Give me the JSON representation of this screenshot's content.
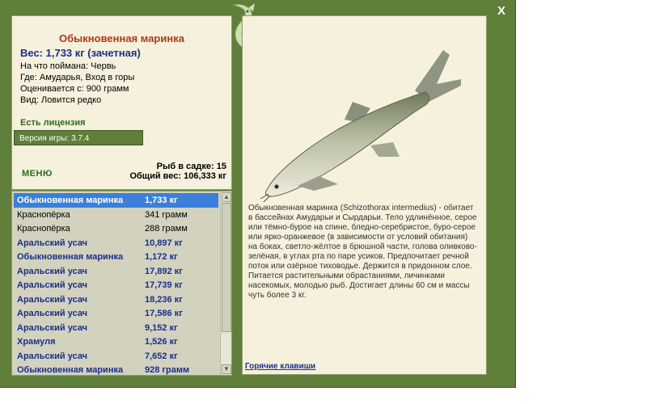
{
  "window": {
    "close_label": "X"
  },
  "fish": {
    "title": "Обыкновенная маринка",
    "weight": "Вес: 1,733 кг (зачетная)",
    "details": [
      "На что поймана: Червь",
      "Где: Амударья, Вход в горы",
      "Оценивается с: 900 грамм",
      "Вид: Ловится редко"
    ],
    "description": "Обыкновенная маринка (Schizothorax intermedius) - обитает в бассейнах Амударьи и Сырдарьи. Тело удлинённое, серое или тёмно-бурое на спине, бледно-серебристое, буро-серое или ярко-оранжевое (в зависимости от условий обитания) на боках, светло-жёлтое в брюшной части, голова оливково-зелёная, в углах рта по паре усиков. Предпочитает речной поток или озёрное тиховодье. Держится в придонном слое. Питается растительными обрастаниями, личинками насекомых, молодью рыб. Достигает длины 60 см и массы чуть более 3 кг."
  },
  "status": {
    "license": "Есть лицензия",
    "version": "Версия игры: 3.7.4",
    "keep_net_count": "Рыб в садке: 15",
    "total_weight": "Общий вес: 106,333 кг"
  },
  "menu": {
    "label": "МЕНЮ"
  },
  "links": {
    "hotkeys": "Горячие клавиши"
  },
  "catch_list": [
    {
      "name": "Обыкновенная маринка",
      "weight": "1,733 кг",
      "trophy": true,
      "selected": true
    },
    {
      "name": "Краснопёрка",
      "weight": "341 грамм",
      "trophy": false,
      "selected": false
    },
    {
      "name": "Краснопёрка",
      "weight": "288 грамм",
      "trophy": false,
      "selected": false
    },
    {
      "name": "Аральский усач",
      "weight": "10,897 кг",
      "trophy": true,
      "selected": false
    },
    {
      "name": "Обыкновенная маринка",
      "weight": "1,172 кг",
      "trophy": true,
      "selected": false
    },
    {
      "name": "Аральский усач",
      "weight": "17,892 кг",
      "trophy": true,
      "selected": false
    },
    {
      "name": "Аральский усач",
      "weight": "17,739 кг",
      "trophy": true,
      "selected": false
    },
    {
      "name": "Аральский усач",
      "weight": "18,236 кг",
      "trophy": true,
      "selected": false
    },
    {
      "name": "Аральский усач",
      "weight": "17,586 кг",
      "trophy": true,
      "selected": false
    },
    {
      "name": "Аральский усач",
      "weight": "9,152 кг",
      "trophy": true,
      "selected": false
    },
    {
      "name": "Храмуля",
      "weight": "1,526 кг",
      "trophy": true,
      "selected": false
    },
    {
      "name": "Аральский усач",
      "weight": "7,652 кг",
      "trophy": true,
      "selected": false
    },
    {
      "name": "Обыкновенная маринка",
      "weight": "928 грамм",
      "trophy": true,
      "selected": false
    }
  ],
  "colors": {
    "frame_green": "#5f7f3a",
    "panel_cream": "#f5f1dc",
    "title_red": "#b0381a",
    "trophy_blue": "#1a2f8a",
    "license_green": "#2e6b1f",
    "selection_blue": "#3b7fd9"
  },
  "icons": {
    "logo": "fish-logo-icon",
    "close": "close-icon"
  }
}
